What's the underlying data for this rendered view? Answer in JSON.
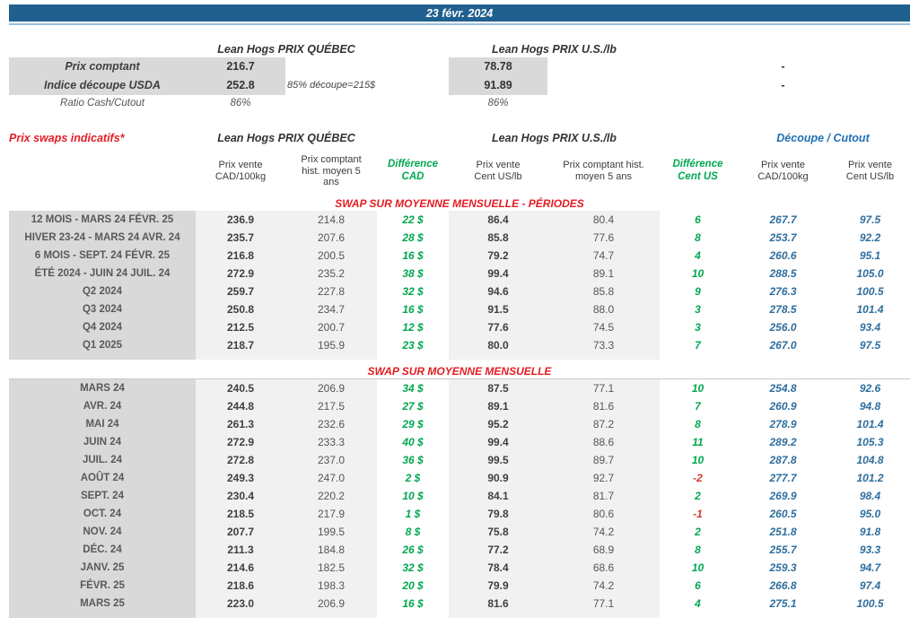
{
  "date_bar": "23 févr. 2024",
  "colors": {
    "header_blue": "#20608f",
    "underline_blue": "#9cc0de",
    "positive_green": "#00a84f",
    "section_red": "#e31c23",
    "negative_red": "#d03a26",
    "cutout_value_blue": "#2e6e9e",
    "cutout_header_blue": "#2071b5",
    "label_gray": "#d9d9d9",
    "band_gray": "#f1f1f1"
  },
  "spot": {
    "qc_header": "Lean Hogs PRIX QUÉBEC",
    "us_header": "Lean Hogs PRIX U.S./lb",
    "rows": [
      {
        "label": "Prix comptant",
        "qc": "216.7",
        "note": "",
        "us": "78.78",
        "dash": "-"
      },
      {
        "label": "Indice découpe USDA",
        "qc": "252.8",
        "note": "85% découpe=215$",
        "us": "91.89",
        "dash": "-"
      },
      {
        "label": "Ratio Cash/Cutout",
        "qc": "86%",
        "note": "",
        "us": "86%",
        "dash": ""
      }
    ]
  },
  "swaps": {
    "title": "Prix swaps indicatifs*",
    "qc_header": "Lean Hogs PRIX QUÉBEC",
    "us_header": "Lean Hogs PRIX U.S./lb",
    "cutout_header": "Découpe / Cutout",
    "columns": [
      "Prix vente\nCAD/100kg",
      "Prix comptant\nhist. moyen 5\nans",
      "Différence\nCAD",
      "Prix vente\nCent US/lb",
      "Prix comptant hist.\nmoyen 5 ans",
      "Différence\nCent US",
      "Prix vente\nCAD/100kg",
      "Prix vente\nCent US/lb"
    ],
    "sections": [
      {
        "header": "SWAP SUR MOYENNE MENSUELLE - PÉRIODES",
        "rows": [
          {
            "label": "12 MOIS - MARS 24 FÉVR. 25",
            "qc_vente": "236.9",
            "qc_hist": "214.8",
            "diff_cad": "22 $",
            "us_vente": "86.4",
            "us_hist": "80.4",
            "diff_us": "6",
            "cut_cad": "267.7",
            "cut_us": "97.5"
          },
          {
            "label": "HIVER 23-24 - MARS 24 AVR. 24",
            "qc_vente": "235.7",
            "qc_hist": "207.6",
            "diff_cad": "28 $",
            "us_vente": "85.8",
            "us_hist": "77.6",
            "diff_us": "8",
            "cut_cad": "253.7",
            "cut_us": "92.2"
          },
          {
            "label": "6 MOIS - SEPT. 24 FÉVR. 25",
            "qc_vente": "216.8",
            "qc_hist": "200.5",
            "diff_cad": "16 $",
            "us_vente": "79.2",
            "us_hist": "74.7",
            "diff_us": "4",
            "cut_cad": "260.6",
            "cut_us": "95.1"
          },
          {
            "label": "ÉTÉ 2024 - JUIN 24 JUIL. 24",
            "qc_vente": "272.9",
            "qc_hist": "235.2",
            "diff_cad": "38 $",
            "us_vente": "99.4",
            "us_hist": "89.1",
            "diff_us": "10",
            "cut_cad": "288.5",
            "cut_us": "105.0"
          },
          {
            "label": "Q2 2024",
            "qc_vente": "259.7",
            "qc_hist": "227.8",
            "diff_cad": "32 $",
            "us_vente": "94.6",
            "us_hist": "85.8",
            "diff_us": "9",
            "cut_cad": "276.3",
            "cut_us": "100.5"
          },
          {
            "label": "Q3 2024",
            "qc_vente": "250.8",
            "qc_hist": "234.7",
            "diff_cad": "16 $",
            "us_vente": "91.5",
            "us_hist": "88.0",
            "diff_us": "3",
            "cut_cad": "278.5",
            "cut_us": "101.4"
          },
          {
            "label": "Q4 2024",
            "qc_vente": "212.5",
            "qc_hist": "200.7",
            "diff_cad": "12 $",
            "us_vente": "77.6",
            "us_hist": "74.5",
            "diff_us": "3",
            "cut_cad": "256.0",
            "cut_us": "93.4"
          },
          {
            "label": "Q1 2025",
            "qc_vente": "218.7",
            "qc_hist": "195.9",
            "diff_cad": "23 $",
            "us_vente": "80.0",
            "us_hist": "73.3",
            "diff_us": "7",
            "cut_cad": "267.0",
            "cut_us": "97.5"
          }
        ]
      },
      {
        "header": "SWAP SUR MOYENNE MENSUELLE",
        "rows": [
          {
            "label": "MARS 24",
            "qc_vente": "240.5",
            "qc_hist": "206.9",
            "diff_cad": "34 $",
            "us_vente": "87.5",
            "us_hist": "77.1",
            "diff_us": "10",
            "cut_cad": "254.8",
            "cut_us": "92.6"
          },
          {
            "label": "AVR. 24",
            "qc_vente": "244.8",
            "qc_hist": "217.5",
            "diff_cad": "27 $",
            "us_vente": "89.1",
            "us_hist": "81.6",
            "diff_us": "7",
            "cut_cad": "260.9",
            "cut_us": "94.8"
          },
          {
            "label": "MAI 24",
            "qc_vente": "261.3",
            "qc_hist": "232.6",
            "diff_cad": "29 $",
            "us_vente": "95.2",
            "us_hist": "87.2",
            "diff_us": "8",
            "cut_cad": "278.9",
            "cut_us": "101.4"
          },
          {
            "label": "JUIN 24",
            "qc_vente": "272.9",
            "qc_hist": "233.3",
            "diff_cad": "40 $",
            "us_vente": "99.4",
            "us_hist": "88.6",
            "diff_us": "11",
            "cut_cad": "289.2",
            "cut_us": "105.3"
          },
          {
            "label": "JUIL. 24",
            "qc_vente": "272.8",
            "qc_hist": "237.0",
            "diff_cad": "36 $",
            "us_vente": "99.5",
            "us_hist": "89.7",
            "diff_us": "10",
            "cut_cad": "287.8",
            "cut_us": "104.8"
          },
          {
            "label": "AOÛT 24",
            "qc_vente": "249.3",
            "qc_hist": "247.0",
            "diff_cad": "2 $",
            "us_vente": "90.9",
            "us_hist": "92.7",
            "diff_us": "-2",
            "cut_cad": "277.7",
            "cut_us": "101.2"
          },
          {
            "label": "SEPT. 24",
            "qc_vente": "230.4",
            "qc_hist": "220.2",
            "diff_cad": "10 $",
            "us_vente": "84.1",
            "us_hist": "81.7",
            "diff_us": "2",
            "cut_cad": "269.9",
            "cut_us": "98.4"
          },
          {
            "label": "OCT. 24",
            "qc_vente": "218.5",
            "qc_hist": "217.9",
            "diff_cad": "1 $",
            "us_vente": "79.8",
            "us_hist": "80.6",
            "diff_us": "-1",
            "cut_cad": "260.5",
            "cut_us": "95.0"
          },
          {
            "label": "NOV. 24",
            "qc_vente": "207.7",
            "qc_hist": "199.5",
            "diff_cad": "8 $",
            "us_vente": "75.8",
            "us_hist": "74.2",
            "diff_us": "2",
            "cut_cad": "251.8",
            "cut_us": "91.8"
          },
          {
            "label": "DÉC. 24",
            "qc_vente": "211.3",
            "qc_hist": "184.8",
            "diff_cad": "26 $",
            "us_vente": "77.2",
            "us_hist": "68.9",
            "diff_us": "8",
            "cut_cad": "255.7",
            "cut_us": "93.3"
          },
          {
            "label": "JANV. 25",
            "qc_vente": "214.6",
            "qc_hist": "182.5",
            "diff_cad": "32 $",
            "us_vente": "78.4",
            "us_hist": "68.6",
            "diff_us": "10",
            "cut_cad": "259.3",
            "cut_us": "94.7"
          },
          {
            "label": "FÉVR. 25",
            "qc_vente": "218.6",
            "qc_hist": "198.3",
            "diff_cad": "20 $",
            "us_vente": "79.9",
            "us_hist": "74.2",
            "diff_us": "6",
            "cut_cad": "266.8",
            "cut_us": "97.4"
          },
          {
            "label": "MARS 25",
            "qc_vente": "223.0",
            "qc_hist": "206.9",
            "diff_cad": "16 $",
            "us_vente": "81.6",
            "us_hist": "77.1",
            "diff_us": "4",
            "cut_cad": "275.1",
            "cut_us": "100.5"
          }
        ]
      }
    ]
  }
}
